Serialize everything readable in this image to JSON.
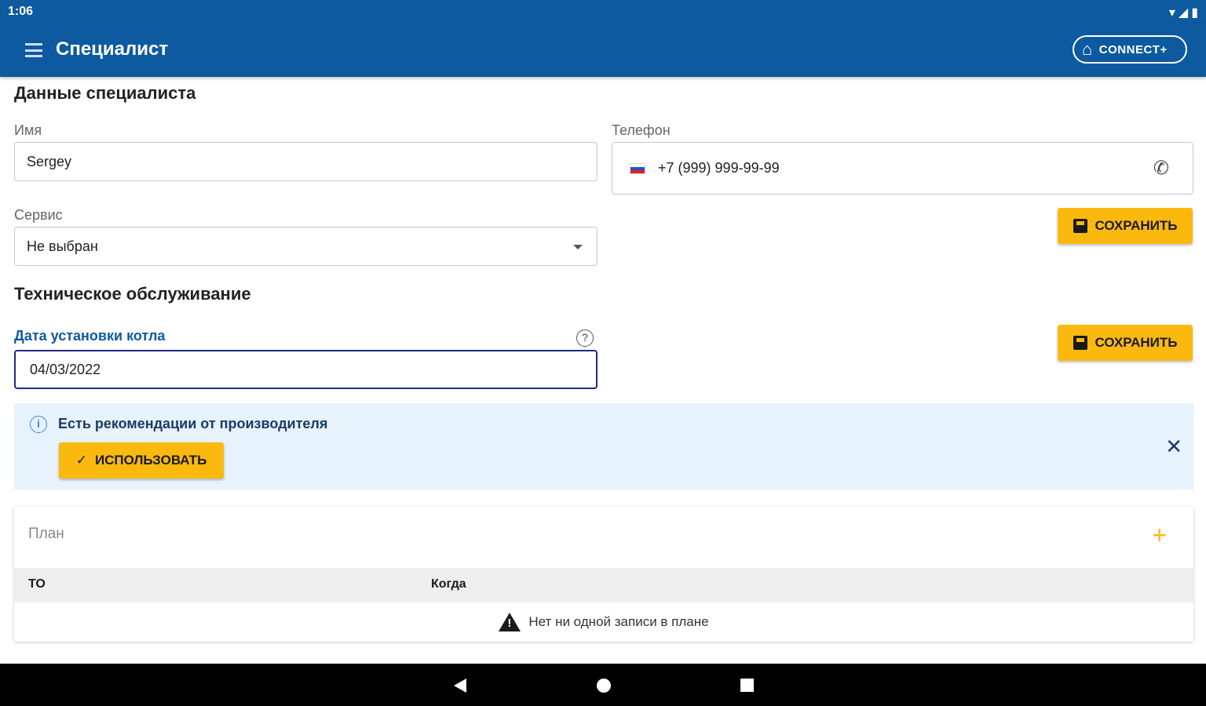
{
  "status_bar": {
    "time": "1:06",
    "wifi": "▾",
    "signal": "◢",
    "battery": "▮"
  },
  "app_bar": {
    "title": "Специалист",
    "connect_label": "CONNECT+"
  },
  "specialist": {
    "heading": "Данные специалиста",
    "name_label": "Имя",
    "name_value": "Sergey",
    "phone_label": "Телефон",
    "phone_value": "+7 (999) 999-99-99",
    "service_label": "Сервис",
    "service_value": "Не выбран",
    "save_label": "СОХРАНИТЬ"
  },
  "maintenance": {
    "heading": "Техническое обслуживание",
    "install_date_label": "Дата установки котла",
    "install_date_value": "04/03/2022",
    "help_glyph": "?",
    "save_label": "СОХРАНИТЬ"
  },
  "banner": {
    "info_glyph": "i",
    "text": "Есть рекомендации от производителя",
    "use_label": "ИСПОЛЬЗОВАТЬ",
    "check_glyph": "✓",
    "close_glyph": "✕"
  },
  "plan": {
    "title": "План",
    "add_glyph": "+",
    "columns": [
      "ТО",
      "Когда"
    ],
    "empty_text": "Нет ни одной записи в плане"
  },
  "colors": {
    "primary": "#0d5aa0",
    "accent": "#fbb90f",
    "banner_bg": "#e6f2fc"
  }
}
